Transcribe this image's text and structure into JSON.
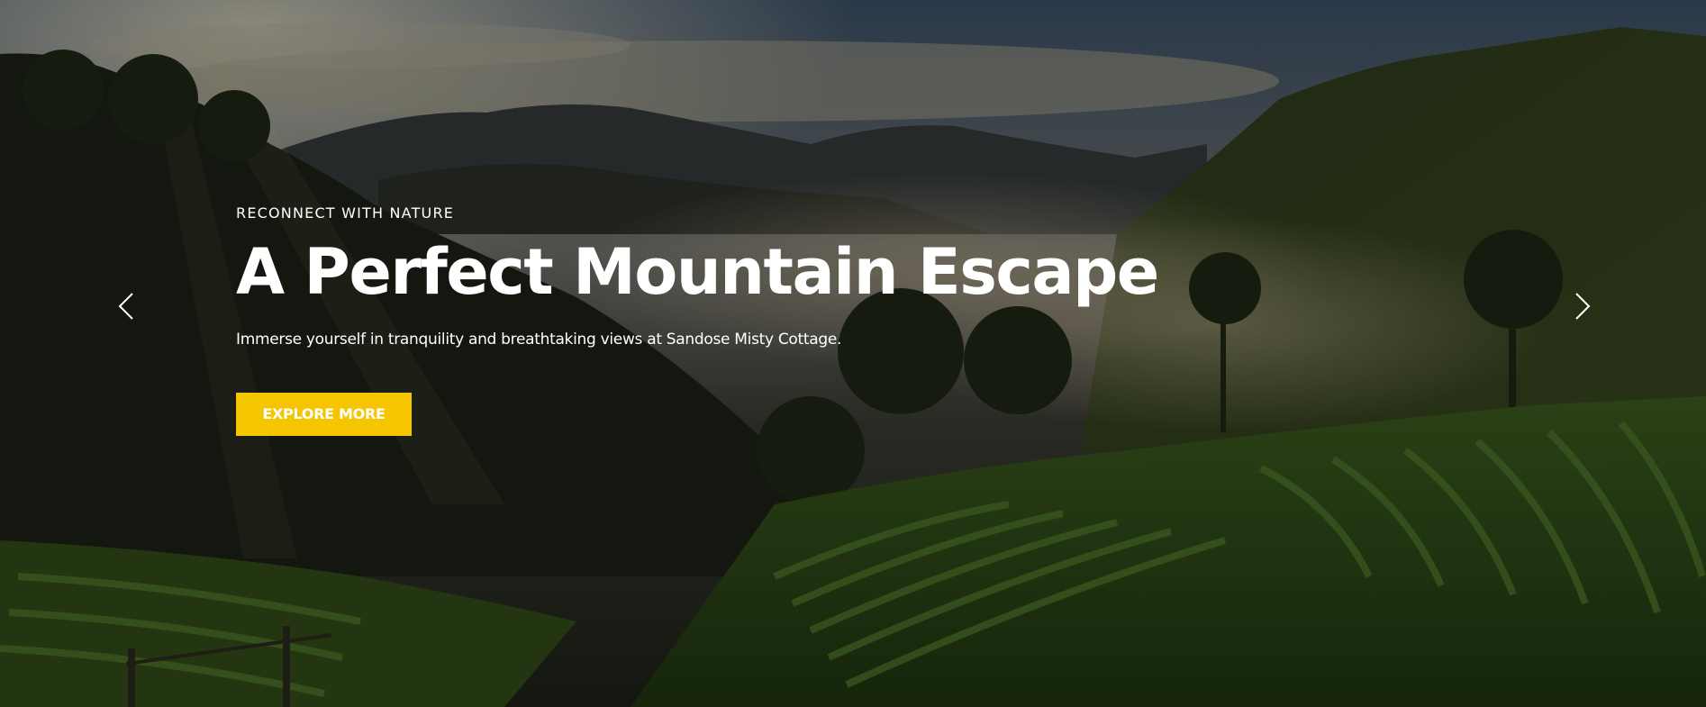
{
  "hero": {
    "eyebrow": "RECONNECT WITH NATURE",
    "headline": "A Perfect Mountain Escape",
    "subtext": "Immerse yourself in tranquility and breathtaking views at Sandose Misty Cottage.",
    "cta_label": "EXPLORE MORE",
    "accent_color": "#f5c500",
    "background_image": "misty mountains with terraced strawberry fields at sunrise"
  },
  "navigation": {
    "prev_icon": "chevron-left-icon",
    "next_icon": "chevron-right-icon"
  }
}
